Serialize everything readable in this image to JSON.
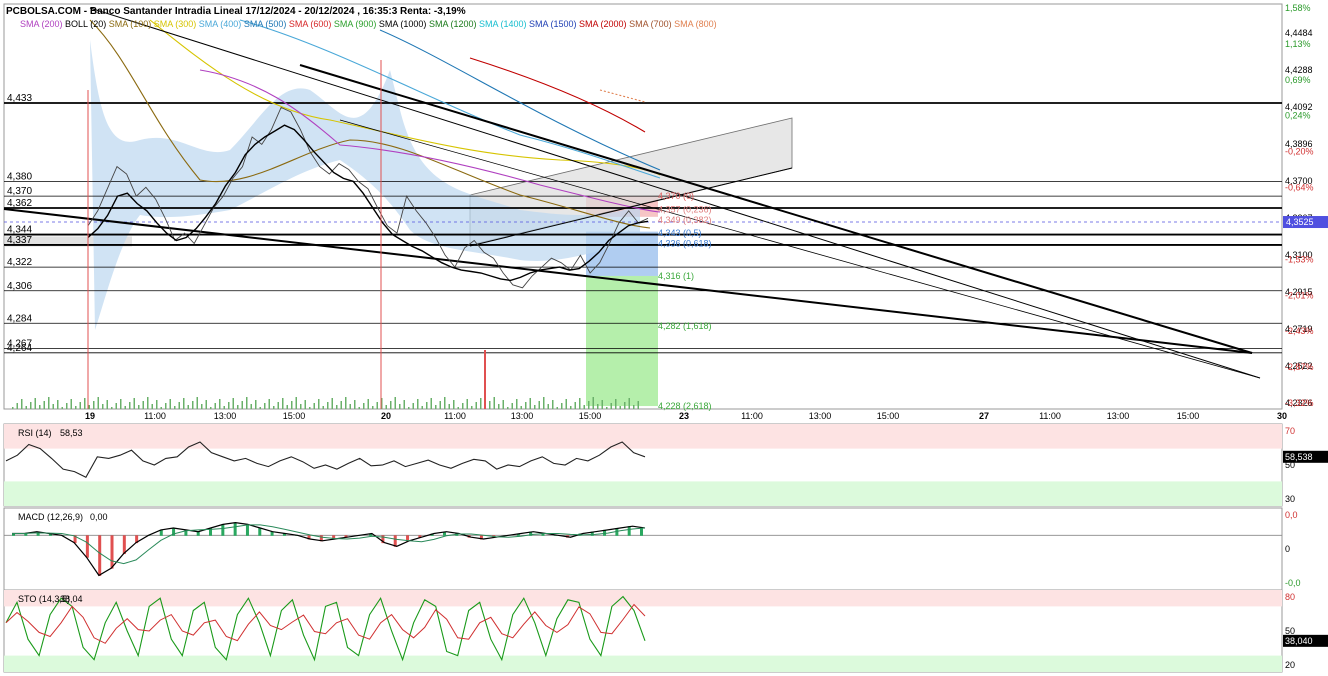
{
  "header": {
    "title": "PCBOLSA.COM - Banco Santander Intradia Lineal 17/12/2024 - 20/12/2024 , 16:35:3 Renta: -3,19%",
    "legend": [
      {
        "label": "SMA (200)",
        "color": "#b040c0"
      },
      {
        "label": "BOLL (20)",
        "color": "#000000"
      },
      {
        "label": "SMA (100)",
        "color": "#8b6a10"
      },
      {
        "label": "SMA (300)",
        "color": "#d6c400"
      },
      {
        "label": "SMA (400)",
        "color": "#4aa8d8"
      },
      {
        "label": "SMA (500)",
        "color": "#1f77b4"
      },
      {
        "label": "SMA (600)",
        "color": "#d62728"
      },
      {
        "label": "SMA (900)",
        "color": "#2ca02c"
      },
      {
        "label": "SMA (1000)",
        "color": "#000000"
      },
      {
        "label": "SMA (1200)",
        "color": "#1a7a1a"
      },
      {
        "label": "SMA (1400)",
        "color": "#17becf"
      },
      {
        "label": "SMA (1500)",
        "color": "#1f3fb4"
      },
      {
        "label": "SMA (2000)",
        "color": "#c00000"
      },
      {
        "label": "SMA (700)",
        "color": "#a0522d"
      },
      {
        "label": "SMA (800)",
        "color": "#e08050"
      }
    ]
  },
  "chart_data": [
    {
      "type": "line",
      "name": "price",
      "ylim": [
        4.226,
        4.5
      ],
      "x_ticks": [
        "19",
        "11:00",
        "13:00",
        "15:00",
        "20",
        "11:00",
        "13:00",
        "15:00",
        "23",
        "11:00",
        "13:00",
        "15:00",
        "27",
        "11:00",
        "13:00",
        "15:00",
        "30"
      ],
      "right_ticks": [
        "4,4484",
        "4,4288",
        "4,4092",
        "4,3896",
        "4,3700",
        "4,3307",
        "4,3100",
        "4,2915",
        "4,2719",
        "4,2522",
        "4,2326"
      ],
      "right_pct": [
        "1,58%",
        "1,13%",
        "0,69%",
        "0,24%",
        "-0,20%",
        "-0,64%",
        "-1,09%",
        "-1,53%",
        "-2,01%",
        "-2,43%",
        "-2,87%",
        "-3,32%"
      ],
      "current_value": "4,3525",
      "levels": [
        {
          "label": "4,433",
          "value": 4.433
        },
        {
          "label": "4,380",
          "value": 4.38
        },
        {
          "label": "4,370",
          "value": 4.37
        },
        {
          "label": "4,362",
          "value": 4.362
        },
        {
          "label": "4,344",
          "value": 4.344
        },
        {
          "label": "4,337",
          "value": 4.337
        },
        {
          "label": "4,322",
          "value": 4.322
        },
        {
          "label": "4,306",
          "value": 4.306
        },
        {
          "label": "4,284",
          "value": 4.284
        },
        {
          "label": "4,267",
          "value": 4.267
        },
        {
          "label": "4,264",
          "value": 4.264
        }
      ],
      "fib_labels": [
        {
          "label": "4,370 (0)",
          "value": 4.37,
          "color": "#e06060"
        },
        {
          "label": "4,357 (0,236)",
          "value": 4.361,
          "color": "#e08080"
        },
        {
          "label": "4,349 (0,382)",
          "value": 4.354,
          "color": "#e08080"
        },
        {
          "label": "4,343 (0,5)",
          "value": 4.345,
          "color": "#3a7ad0"
        },
        {
          "label": "4,336 (0,618)",
          "value": 4.338,
          "color": "#3a7ad0"
        },
        {
          "label": "4,316 (1)",
          "value": 4.316,
          "color": "#3aa83a"
        },
        {
          "label": "4,282 (1,618)",
          "value": 4.282,
          "color": "#3aa83a"
        },
        {
          "label": "4,228 (2,618)",
          "value": 4.228,
          "color": "#3aa83a"
        }
      ],
      "price_series": [
        4.35,
        4.36,
        4.375,
        4.39,
        4.385,
        4.37,
        4.376,
        4.368,
        4.355,
        4.34,
        4.345,
        4.338,
        4.35,
        4.362,
        4.37,
        4.382,
        4.39,
        4.41,
        4.405,
        4.415,
        4.43,
        4.427,
        4.415,
        4.4,
        4.39,
        4.385,
        4.392,
        4.388,
        4.38,
        4.375,
        4.362,
        4.35,
        4.345,
        4.37,
        4.36,
        4.352,
        4.342,
        4.33,
        4.322,
        4.335,
        4.34,
        4.332,
        4.328,
        4.318,
        4.31,
        4.308,
        4.316,
        4.322,
        4.328,
        4.325,
        4.32,
        4.33,
        4.318,
        4.325,
        4.338,
        4.352,
        4.36,
        4.352,
        4.355
      ],
      "sma_black_series": [
        4.342,
        4.348,
        4.357,
        4.37,
        4.372,
        4.365,
        4.36,
        4.352,
        4.345,
        4.34,
        4.342,
        4.348,
        4.356,
        4.365,
        4.377,
        4.386,
        4.398,
        4.405,
        4.41,
        4.414,
        4.418,
        4.415,
        4.408,
        4.4,
        4.393,
        4.386,
        4.382,
        4.38,
        4.372,
        4.362,
        4.352,
        4.344,
        4.34,
        4.336,
        4.333,
        4.329,
        4.325,
        4.322,
        4.32,
        4.319,
        4.318,
        4.316,
        4.314,
        4.313,
        4.315,
        4.318,
        4.32,
        4.321,
        4.322,
        4.32,
        4.321,
        4.326,
        4.332,
        4.34,
        4.345,
        4.35,
        4.352,
        4.353
      ]
    },
    {
      "type": "line",
      "name": "RSI (14)",
      "label": "RSI (14)",
      "value_label": "58,53",
      "current_value": "58,538",
      "ylim": [
        0,
        100
      ],
      "ticks": [
        "70",
        "50",
        "30"
      ],
      "values": [
        55,
        62,
        75,
        70,
        58,
        45,
        42,
        35,
        60,
        58,
        62,
        68,
        55,
        50,
        58,
        60,
        72,
        78,
        65,
        60,
        55,
        58,
        52,
        48,
        55,
        60,
        54,
        46,
        50,
        45,
        52,
        58,
        49,
        50,
        55,
        48,
        52,
        56,
        50,
        46,
        52,
        57,
        55,
        45,
        50,
        48,
        55,
        60,
        52,
        50,
        58,
        55,
        62,
        72,
        78,
        65,
        60
      ]
    },
    {
      "type": "bar",
      "name": "MACD (12,26,9)",
      "label": "MACD (12,26,9)",
      "value_label": "0,00",
      "ticks": [
        "0,0",
        "0",
        "-0,0"
      ],
      "ylim": [
        -0.03,
        0.015
      ],
      "values": [
        0.001,
        0.001,
        0.002,
        0.001,
        0,
        -0.004,
        -0.012,
        -0.022,
        -0.018,
        -0.01,
        -0.004,
        0,
        0.003,
        0.004,
        0.003,
        0.002,
        0.004,
        0.006,
        0.007,
        0.006,
        0.004,
        0.002,
        0.001,
        0,
        -0.002,
        -0.003,
        -0.002,
        -0.001,
        0,
        0.001,
        -0.004,
        -0.006,
        -0.003,
        -0.001,
        0.001,
        0.002,
        0.001,
        -0.001,
        -0.002,
        -0.001,
        0,
        0.001,
        0.002,
        0.001,
        0,
        -0.001,
        0.001,
        0.002,
        0.003,
        0.004,
        0.005,
        0.004
      ]
    },
    {
      "type": "line",
      "name": "STO (14,3,5)",
      "label": "STO (14,3,5)",
      "value_label": "38,04",
      "current_value": "38,040",
      "ylim": [
        0,
        100
      ],
      "ticks": [
        "80",
        "50",
        "20"
      ],
      "values": [
        60,
        85,
        40,
        20,
        70,
        90,
        80,
        30,
        15,
        60,
        85,
        50,
        20,
        80,
        90,
        40,
        20,
        75,
        85,
        30,
        15,
        70,
        90,
        60,
        20,
        75,
        88,
        45,
        15,
        80,
        85,
        30,
        20,
        70,
        90,
        50,
        15,
        60,
        88,
        80,
        25,
        20,
        75,
        85,
        40,
        15,
        70,
        90,
        60,
        20,
        65,
        88,
        85,
        40,
        20,
        80,
        92,
        75,
        38
      ]
    }
  ]
}
